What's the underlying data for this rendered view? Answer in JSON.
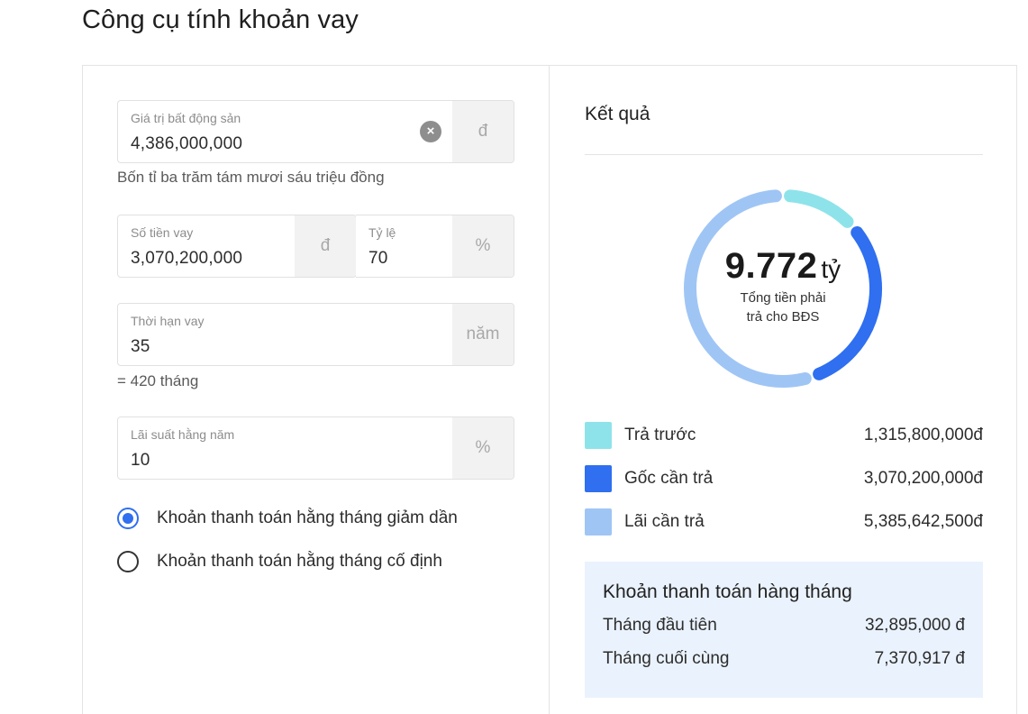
{
  "page_title": "Công cụ tính khoản vay",
  "form": {
    "property_value": {
      "label": "Giá trị bất động sản",
      "value": "4,386,000,000",
      "unit": "đ",
      "hint": "Bốn tỉ ba trăm tám mươi sáu triệu đồng",
      "clear_icon": "close-icon"
    },
    "loan_amount": {
      "label": "Số tiền vay",
      "value": "3,070,200,000",
      "unit": "đ"
    },
    "ratio": {
      "label": "Tỷ lệ",
      "value": "70",
      "unit": "%"
    },
    "term": {
      "label": "Thời hạn vay",
      "value": "35",
      "unit": "năm",
      "hint": "= 420 tháng"
    },
    "interest": {
      "label": "Lãi suất hằng năm",
      "value": "10",
      "unit": "%"
    },
    "payment_options": [
      {
        "label": "Khoản thanh toán hằng tháng giảm dần",
        "checked": true
      },
      {
        "label": "Khoản thanh toán hằng tháng cố định",
        "checked": false
      }
    ]
  },
  "result": {
    "title": "Kết quả",
    "total_amount": "9.772",
    "total_unit": "tỷ",
    "total_caption_line1": "Tổng tiền phải",
    "total_caption_line2": "trả cho BĐS",
    "legend": [
      {
        "name": "Trả trước",
        "value": "1,315,800,000đ",
        "amount": 1315800000,
        "color": "#8ee3ea"
      },
      {
        "name": "Gốc cần trả",
        "value": "3,070,200,000đ",
        "amount": 3070200000,
        "color": "#2f6ff0"
      },
      {
        "name": "Lãi cần trả",
        "value": "5,385,642,500đ",
        "amount": 5385642500,
        "color": "#9fc5f5"
      }
    ],
    "monthly": {
      "title": "Khoản thanh toán hàng tháng",
      "first_label": "Tháng đầu tiên",
      "first_value": "32,895,000 đ",
      "last_label": "Tháng cuối cùng",
      "last_value": "7,370,917 đ"
    }
  }
}
